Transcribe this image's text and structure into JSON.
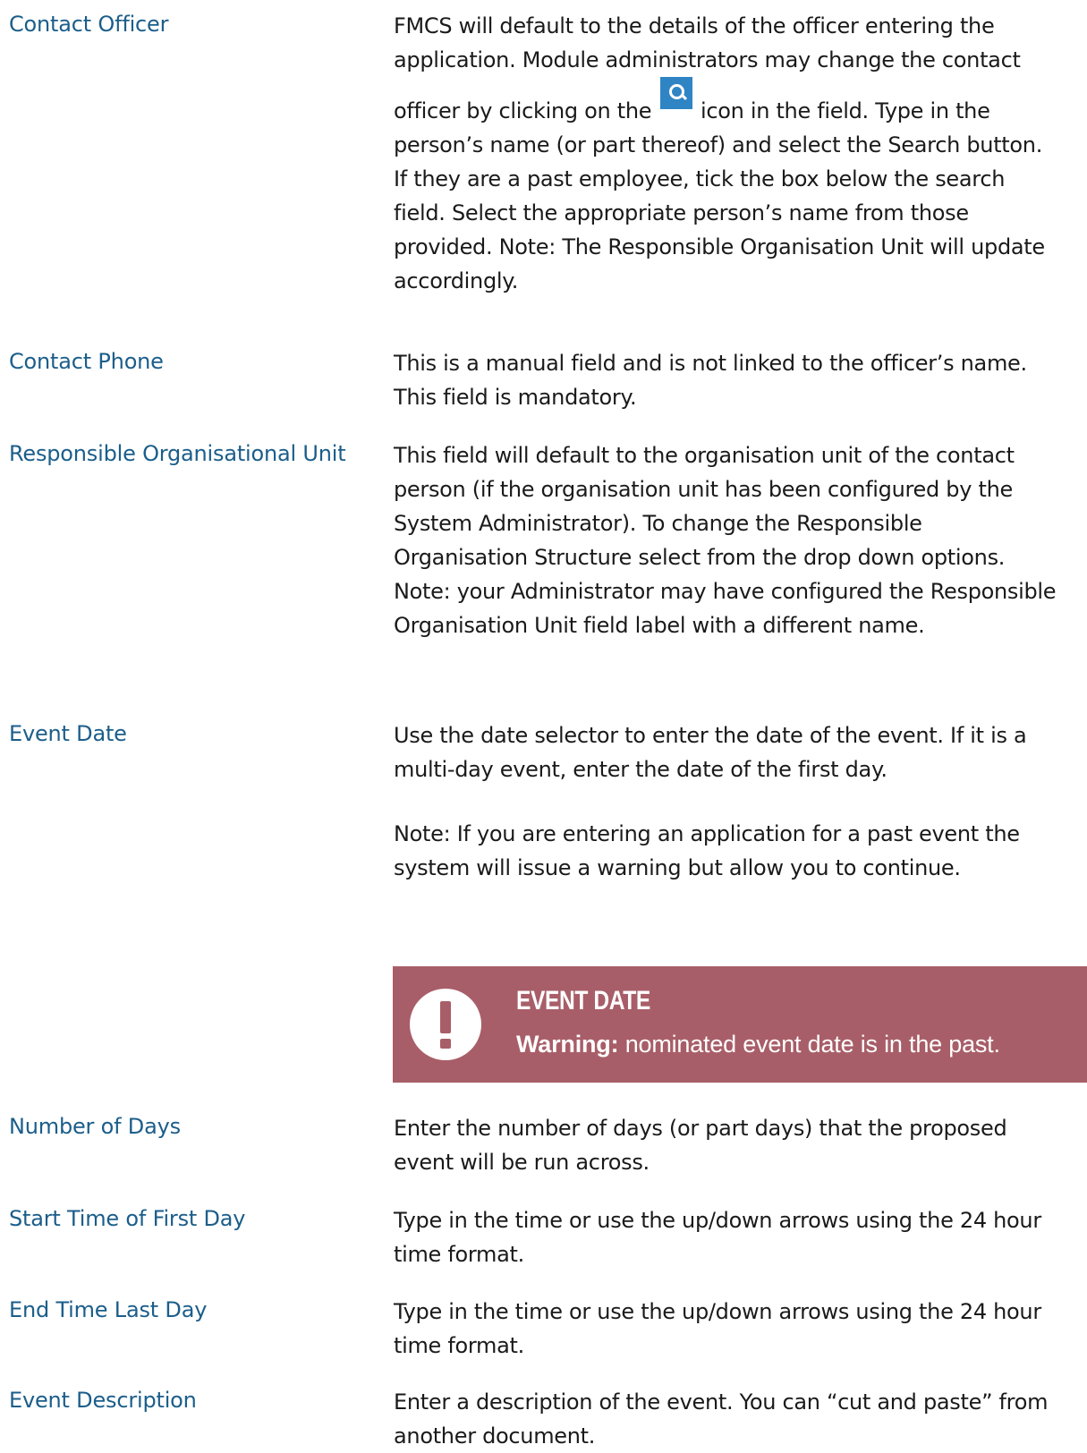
{
  "fields": [
    {
      "label": "Contact Officer",
      "text_before_icon": "FMCS will default to the details of the officer entering the application. Module administrators may change the contact officer by clicking on the",
      "icon": "search-icon",
      "text_after_icon": "icon in the field. Type in the person’s name (or part thereof) and select the Search button. If they are a past employee, tick the box below the search field. Select the appropriate person’s name from those provided. Note: The Responsible Organisation Unit will update accordingly."
    },
    {
      "label": "Contact Phone",
      "text": "This is a manual field and is not linked to the officer’s name. This field is mandatory."
    },
    {
      "label": "Responsible Organisational Unit",
      "text": "This field will default to the organisation unit of the contact person (if the organisation unit has been configured by the System Administrator). To change the Responsible Organisation Structure select from the drop down options. Note: your Administrator may have configured the Responsible Organisation Unit field label with a different name."
    },
    {
      "label": "Event Date",
      "text": "Use the date selector to enter the date of the event. If it is a multi-day event, enter the date of the first day.",
      "note": "Note: If you are entering an application for a past event the system will issue a warning but allow you to continue."
    },
    {
      "label": "Number of Days",
      "text": "Enter the number of days (or part days) that the proposed event will be run across."
    },
    {
      "label": "Start Time of First Day",
      "text": "Type in the time or use the up/down arrows using the 24 hour time format."
    },
    {
      "label": "End Time Last Day",
      "text": "Type in the time or use the up/down arrows using the 24 hour time format."
    },
    {
      "label": "Event Description",
      "text": "Enter a description of the event. You can “cut and paste” from another document."
    }
  ],
  "warning": {
    "icon": "exclamation-icon",
    "title": "EVENT DATE",
    "message_prefix": "Warning:",
    "message": "nominated event date is in the past.",
    "background_color": "#a85e68"
  },
  "colors": {
    "label": "#1b5e8a",
    "body_text": "#1a1a1a",
    "search_icon": "#2f84c4"
  }
}
